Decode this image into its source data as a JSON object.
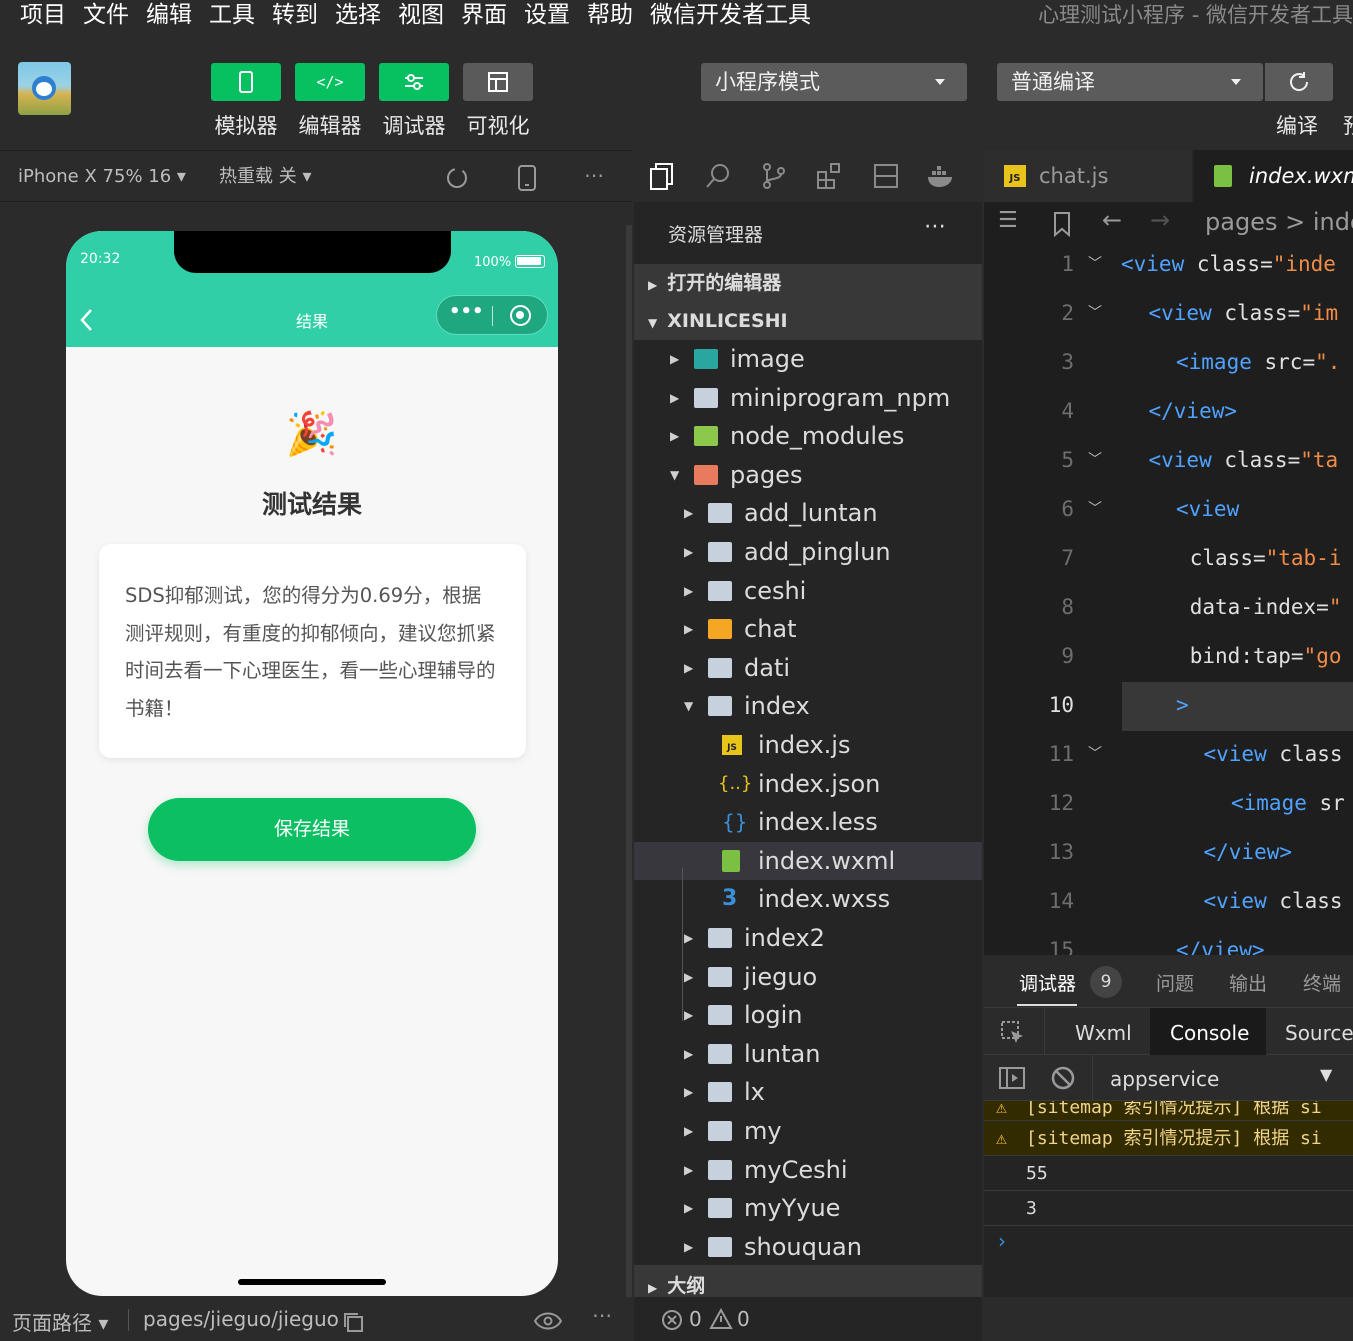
{
  "menubar": {
    "items": [
      "项目",
      "文件",
      "编辑",
      "工具",
      "转到",
      "选择",
      "视图",
      "界面",
      "设置",
      "帮助",
      "微信开发者工具"
    ],
    "window_title": "心理测试小程序 - 微信开发者工具"
  },
  "toolbar": {
    "buttons": [
      {
        "label": "模拟器",
        "icon": "phone-icon"
      },
      {
        "label": "编辑器",
        "icon": "code-icon"
      },
      {
        "label": "调试器",
        "icon": "debug-icon"
      },
      {
        "label": "可视化",
        "icon": "layout-icon"
      }
    ],
    "mode_select": "小程序模式",
    "compile_select": "普通编译",
    "compile_label": "编译",
    "preview_label_partial": "预"
  },
  "simulator": {
    "device": "iPhone X 75% 16 ▾",
    "hot_reload": "热重载 关 ▾",
    "phone": {
      "time": "20:32",
      "battery": "100%",
      "nav_title": "结果",
      "emoji": "🎉",
      "page_title": "测试结果",
      "result_text": "SDS抑郁测试，您的得分为0.69分，根据测评规则，有重度的抑郁倾向，建议您抓紧时间去看一下心理医生，看一些心理辅导的书籍！",
      "save_button": "保存结果"
    }
  },
  "explorer": {
    "title": "资源管理器",
    "open_editors": "打开的编辑器",
    "project": "XINLICESHI",
    "outline": "大纲",
    "tree": [
      {
        "name": "image",
        "depth": 0,
        "type": "folder-img",
        "open": false
      },
      {
        "name": "miniprogram_npm",
        "depth": 0,
        "type": "folder",
        "open": false
      },
      {
        "name": "node_modules",
        "depth": 0,
        "type": "folder-node",
        "open": false
      },
      {
        "name": "pages",
        "depth": 0,
        "type": "folder-pages",
        "open": true
      },
      {
        "name": "add_luntan",
        "depth": 1,
        "type": "folder",
        "open": false
      },
      {
        "name": "add_pinglun",
        "depth": 1,
        "type": "folder",
        "open": false
      },
      {
        "name": "ceshi",
        "depth": 1,
        "type": "folder",
        "open": false
      },
      {
        "name": "chat",
        "depth": 1,
        "type": "folder-chat",
        "open": false
      },
      {
        "name": "dati",
        "depth": 1,
        "type": "folder",
        "open": false
      },
      {
        "name": "index",
        "depth": 1,
        "type": "folder",
        "open": true
      },
      {
        "name": "index.js",
        "depth": 2,
        "type": "js"
      },
      {
        "name": "index.json",
        "depth": 2,
        "type": "json"
      },
      {
        "name": "index.less",
        "depth": 2,
        "type": "less"
      },
      {
        "name": "index.wxml",
        "depth": 2,
        "type": "wxml",
        "selected": true
      },
      {
        "name": "index.wxss",
        "depth": 2,
        "type": "wxss"
      },
      {
        "name": "index2",
        "depth": 1,
        "type": "folder",
        "open": false
      },
      {
        "name": "jieguo",
        "depth": 1,
        "type": "folder",
        "open": false
      },
      {
        "name": "login",
        "depth": 1,
        "type": "folder",
        "open": false
      },
      {
        "name": "luntan",
        "depth": 1,
        "type": "folder",
        "open": false
      },
      {
        "name": "lx",
        "depth": 1,
        "type": "folder",
        "open": false
      },
      {
        "name": "my",
        "depth": 1,
        "type": "folder",
        "open": false
      },
      {
        "name": "myCeshi",
        "depth": 1,
        "type": "folder",
        "open": false
      },
      {
        "name": "myYyue",
        "depth": 1,
        "type": "folder",
        "open": false
      },
      {
        "name": "shouquan",
        "depth": 1,
        "type": "folder",
        "open": false
      }
    ]
  },
  "editor": {
    "tabs": [
      "chat.js",
      "index.wxm"
    ],
    "breadcrumb": "pages > inde",
    "lines": [
      {
        "n": "1",
        "fold": true,
        "indent": 0,
        "parts": [
          [
            "tg",
            "<view "
          ],
          [
            "at",
            "class="
          ],
          [
            "st",
            "\"inde"
          ]
        ]
      },
      {
        "n": "2",
        "fold": true,
        "indent": 1,
        "parts": [
          [
            "tg",
            "<view "
          ],
          [
            "at",
            "class="
          ],
          [
            "st",
            "\"im"
          ]
        ]
      },
      {
        "n": "3",
        "fold": false,
        "indent": 2,
        "parts": [
          [
            "tg",
            "<image "
          ],
          [
            "at",
            "src="
          ],
          [
            "st",
            "\"."
          ]
        ]
      },
      {
        "n": "4",
        "fold": false,
        "indent": 1,
        "parts": [
          [
            "tg",
            "</view>"
          ]
        ]
      },
      {
        "n": "5",
        "fold": true,
        "indent": 1,
        "parts": [
          [
            "tg",
            "<view "
          ],
          [
            "at",
            "class="
          ],
          [
            "st",
            "\"ta"
          ]
        ]
      },
      {
        "n": "6",
        "fold": true,
        "indent": 2,
        "parts": [
          [
            "tg",
            "<view"
          ]
        ]
      },
      {
        "n": "7",
        "fold": false,
        "indent": 2.5,
        "parts": [
          [
            "at",
            "class="
          ],
          [
            "st",
            "\"tab-i"
          ]
        ]
      },
      {
        "n": "8",
        "fold": false,
        "indent": 2.5,
        "parts": [
          [
            "at",
            "data-index="
          ],
          [
            "st",
            "\""
          ]
        ]
      },
      {
        "n": "9",
        "fold": false,
        "indent": 2.5,
        "parts": [
          [
            "at",
            "bind:tap="
          ],
          [
            "st",
            "\"go"
          ]
        ]
      },
      {
        "n": "10",
        "fold": false,
        "indent": 2,
        "parts": [
          [
            "tg",
            ">"
          ]
        ]
      },
      {
        "n": "11",
        "fold": true,
        "indent": 3,
        "parts": [
          [
            "tg",
            "<view "
          ],
          [
            "at",
            "class"
          ]
        ]
      },
      {
        "n": "12",
        "fold": false,
        "indent": 4,
        "parts": [
          [
            "tg",
            "<image "
          ],
          [
            "at",
            "sr"
          ]
        ]
      },
      {
        "n": "13",
        "fold": false,
        "indent": 3,
        "parts": [
          [
            "tg",
            "</view>"
          ]
        ]
      },
      {
        "n": "14",
        "fold": false,
        "indent": 3,
        "parts": [
          [
            "tg",
            "<view "
          ],
          [
            "at",
            "class"
          ]
        ]
      },
      {
        "n": "15",
        "fold": false,
        "indent": 2,
        "parts": [
          [
            "tg",
            "</view>"
          ]
        ]
      }
    ]
  },
  "debugger": {
    "tabs": [
      "调试器",
      "问题",
      "输出",
      "终端"
    ],
    "badge": "9",
    "subtabs": [
      "Wxml",
      "Console",
      "Sources"
    ],
    "context": "appservice",
    "console": [
      {
        "type": "warn",
        "text": "[sitemap 索引情况提示] 根据 si"
      },
      {
        "type": "warn",
        "text": "[sitemap 索引情况提示] 根据 si"
      },
      {
        "type": "log",
        "text": "55"
      },
      {
        "type": "log",
        "text": "3"
      }
    ]
  },
  "statusbar": {
    "page_path_label": "页面路径 ▾",
    "page_path": "pages/jieguo/jieguo",
    "errors": "0",
    "warnings": "0"
  }
}
